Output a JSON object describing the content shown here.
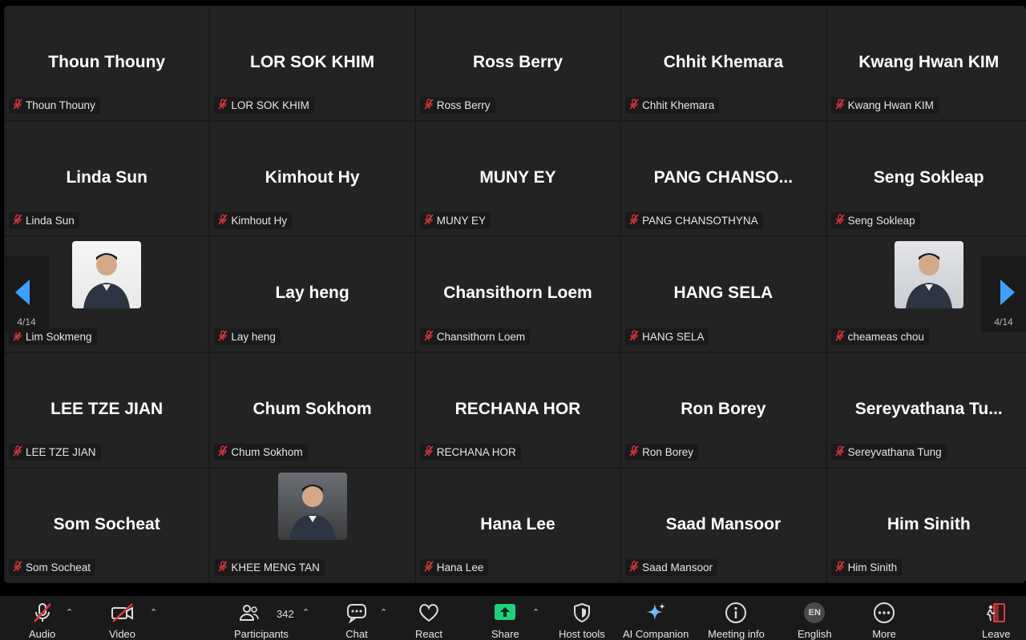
{
  "gallery": {
    "page_indicator": "4/14",
    "participants": [
      {
        "display": "Thoun Thouny",
        "tag": "Thoun Thouny"
      },
      {
        "display": "LOR SOK KHIM",
        "tag": "LOR SOK KHIM"
      },
      {
        "display": "Ross Berry",
        "tag": "Ross Berry"
      },
      {
        "display": "Chhit Khemara",
        "tag": "Chhit Khemara"
      },
      {
        "display": "Kwang Hwan KIM",
        "tag": "Kwang Hwan KIM"
      },
      {
        "display": "Linda Sun",
        "tag": "Linda Sun"
      },
      {
        "display": "Kimhout Hy",
        "tag": "Kimhout Hy"
      },
      {
        "display": "MUNY EY",
        "tag": "MUNY EY"
      },
      {
        "display": "PANG  CHANSO...",
        "tag": "PANG CHANSOTHYNA"
      },
      {
        "display": "Seng Sokleap",
        "tag": "Seng Sokleap"
      },
      {
        "display": "",
        "tag": "Lim Sokmeng",
        "photo": true
      },
      {
        "display": "Lay heng",
        "tag": "Lay heng"
      },
      {
        "display": "Chansithorn Loem",
        "tag": "Chansithorn Loem"
      },
      {
        "display": "HANG SELA",
        "tag": "HANG SELA"
      },
      {
        "display": "",
        "tag": "cheameas chou",
        "photo": true
      },
      {
        "display": "LEE TZE JIAN",
        "tag": "LEE TZE JIAN"
      },
      {
        "display": "Chum Sokhom",
        "tag": "Chum Sokhom"
      },
      {
        "display": "RECHANA HOR",
        "tag": "RECHANA HOR"
      },
      {
        "display": "Ron Borey",
        "tag": "Ron Borey"
      },
      {
        "display": "Sereyvathana  Tu...",
        "tag": "Sereyvathana Tung"
      },
      {
        "display": "Som Socheat",
        "tag": "Som Socheat"
      },
      {
        "display": "",
        "tag": "KHEE MENG TAN",
        "photo": true
      },
      {
        "display": "Hana Lee",
        "tag": "Hana Lee"
      },
      {
        "display": "Saad Mansoor",
        "tag": "Saad Mansoor"
      },
      {
        "display": "Him Sinith",
        "tag": "Him Sinith"
      }
    ]
  },
  "toolbar": {
    "audio": "Audio",
    "video": "Video",
    "participants": "Participants",
    "participants_count": "342",
    "chat": "Chat",
    "react": "React",
    "share": "Share",
    "host_tools": "Host tools",
    "ai_companion": "AI Companion",
    "meeting_info": "Meeting info",
    "english_badge": "EN",
    "english": "English",
    "more": "More",
    "leave": "Leave"
  },
  "colors": {
    "accent": "#3ea0ff",
    "muted_red": "#e0383e",
    "share_green": "#1fd27a"
  }
}
